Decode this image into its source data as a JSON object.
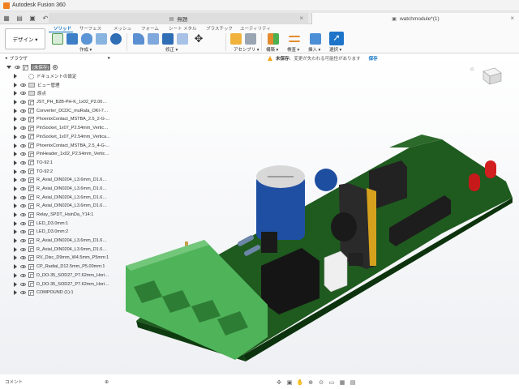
{
  "app": {
    "title": "Autodesk Fusion 360"
  },
  "tabs": {
    "inactive": "無題",
    "active": "watchmodule*(1)"
  },
  "toolbar": {
    "workspace": "デザイン ▾",
    "tabs": [
      "ソリッド",
      "サーフェス",
      "メッシュ",
      "フォーム",
      "シート メタル",
      "プラスチック",
      "ユーティリティ"
    ],
    "groups": [
      "作成 ▾",
      "修正 ▾",
      "アセンブリ ▾",
      "構築 ▾",
      "検査 ▾",
      "挿入 ▾",
      "選択 ▾"
    ]
  },
  "notice": {
    "title": "未保存:",
    "message": "変更が失われる可能性があります",
    "save": "保存"
  },
  "browser": {
    "header": "ブラウザ",
    "root": "(未保存)",
    "items": [
      {
        "label": "ドキュメントの設定",
        "icon": "gear"
      },
      {
        "label": "ビュー管理",
        "icon": "folder"
      },
      {
        "label": "原点",
        "icon": "folder"
      },
      {
        "label": "JST_PH_B2B-PH-K_1x02_P2.00mm...",
        "icon": "component"
      },
      {
        "label": "Converter_DCDC_muRata_OKI-78s...",
        "icon": "component"
      },
      {
        "label": "PhoenixContact_MSTBA_2.5_2-G-...",
        "icon": "component"
      },
      {
        "label": "PinSocket_1x07_P2.54mm_Vertical:1",
        "icon": "component"
      },
      {
        "label": "PinSocket_1x07_P2.54mm_Vertica...",
        "icon": "component"
      },
      {
        "label": "PhoenixContact_MSTBA_2.5_4-G-...",
        "icon": "component"
      },
      {
        "label": "PinHeader_1x02_P2.54mm_Vertica...",
        "icon": "component"
      },
      {
        "label": "TO-92:1",
        "icon": "component"
      },
      {
        "label": "TO-92:2",
        "icon": "component"
      },
      {
        "label": "R_Axial_DIN0204_L3.6mm_D1.6mm...",
        "icon": "component"
      },
      {
        "label": "R_Axial_DIN0204_L3.6mm_D1.6mm...",
        "icon": "component"
      },
      {
        "label": "R_Axial_DIN0204_L3.6mm_D1.6mm...",
        "icon": "component"
      },
      {
        "label": "R_Axial_DIN0204_L3.6mm_D1.6mm...",
        "icon": "component"
      },
      {
        "label": "Relay_SPDT_HsinDa_Y14:1",
        "icon": "component"
      },
      {
        "label": "LED_D3.0mm:1",
        "icon": "component"
      },
      {
        "label": "LED_D3.0mm:2",
        "icon": "component"
      },
      {
        "label": "R_Axial_DIN0204_L3.6mm_D1.6mm...",
        "icon": "component"
      },
      {
        "label": "R_Axial_DIN0204_L3.6mm_D1.6mm...",
        "icon": "component"
      },
      {
        "label": "RV_Disc_D9mm_W4.5mm_P5mm:1",
        "icon": "component"
      },
      {
        "label": "CP_Radial_D12.5mm_P5.00mm:1",
        "icon": "component"
      },
      {
        "label": "D_DO-35_SOD27_P7.62mm_Horiz...",
        "icon": "component"
      },
      {
        "label": "D_DO-35_SOD27_P7.62mm_Horiz...",
        "icon": "component"
      },
      {
        "label": "COMPOUND (1):1",
        "icon": "component"
      }
    ]
  },
  "comments": {
    "label": "コメント"
  },
  "colors": {
    "pcb": "#1f5a1f",
    "pcb_edge": "#0f3b10",
    "terminal": "#4fb35a",
    "capacitor": "#1f4fa3",
    "accent": "#0a6fc2"
  }
}
